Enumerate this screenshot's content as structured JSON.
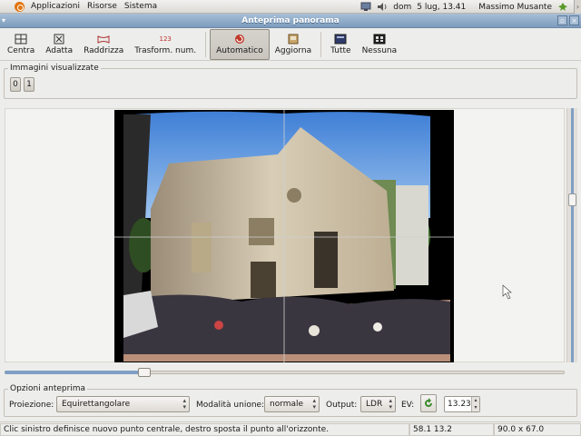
{
  "panel": {
    "menus": [
      "Applicazioni",
      "Risorse",
      "Sistema"
    ],
    "date": "dom",
    "time": "5 lug, 13.41",
    "user": "Massimo Musante"
  },
  "window": {
    "title": "Anteprima panorama"
  },
  "toolbar": {
    "buttons": [
      {
        "label": "Centra",
        "icon": "center-icon"
      },
      {
        "label": "Adatta",
        "icon": "fit-icon"
      },
      {
        "label": "Raddrizza",
        "icon": "straighten-icon"
      },
      {
        "label": "Trasform. num.",
        "icon": "numeric-transform-icon",
        "icon_text": "123"
      },
      {
        "label": "Automatico",
        "icon": "auto-update-icon",
        "active": true
      },
      {
        "label": "Aggiorna",
        "icon": "update-icon"
      },
      {
        "label": "Tutte",
        "icon": "show-all-icon"
      },
      {
        "label": "Nessuna",
        "icon": "show-none-icon"
      }
    ]
  },
  "images_frame": {
    "title": "Immagini visualizzate",
    "images": [
      "0",
      "1"
    ]
  },
  "preview": {
    "horizontal_slider_fraction": 0.25,
    "vertical_slider_fraction": 0.36
  },
  "options": {
    "title": "Opzioni anteprima",
    "projection_label": "Proiezione:",
    "projection_value": "Equirettangolare",
    "blend_label": "Modalità unione:",
    "blend_value": "normale",
    "output_label": "Output:",
    "output_value": "LDR",
    "ev_label": "EV:",
    "ev_value": "13.23"
  },
  "status": {
    "message": "Clic sinistro definisce nuovo punto centrale, destro sposta il punto all'orizzonte.",
    "coords": "58.1 13.2",
    "fov": "90.0 x 67.0"
  },
  "colors": {
    "accent": "#7f9fc4",
    "titlebar": "#8ca8c7",
    "active_icon": "#c0392b"
  }
}
